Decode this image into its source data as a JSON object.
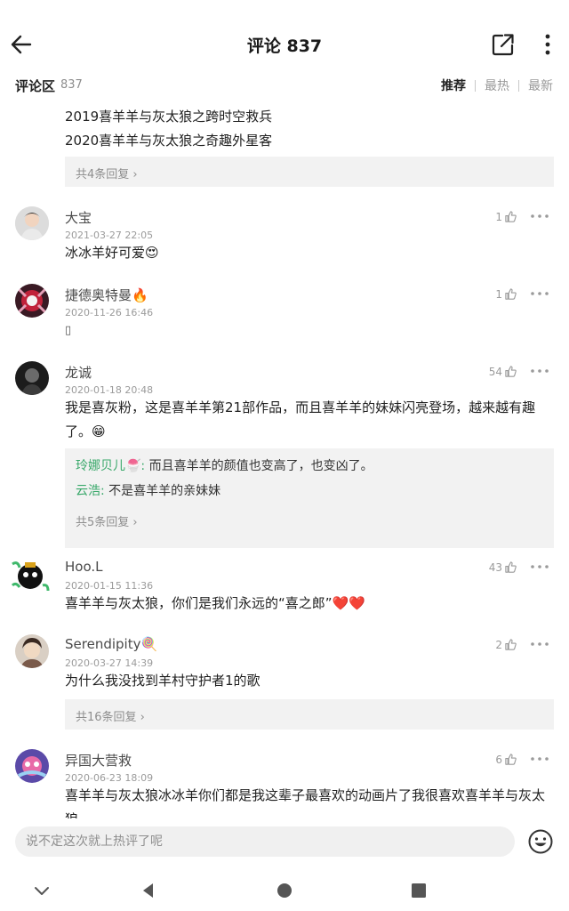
{
  "header": {
    "title": "评论 837"
  },
  "section": {
    "title": "评论区",
    "count": "837",
    "sort": {
      "recommend": "推荐",
      "hot": "最热",
      "latest": "最新"
    }
  },
  "previous_comment_tail": {
    "lines": [
      "2019喜羊羊与灰太狼之跨时空救兵",
      "2020喜羊羊与灰太狼之奇趣外星客"
    ],
    "more_replies": "共4条回复 ›"
  },
  "comments": [
    {
      "name": "大宝",
      "time": "2021-03-27 22:05",
      "text": "冰冰羊好可爱😍",
      "likes": "1"
    },
    {
      "name": "捷德奥特曼🔥",
      "time": "2020-11-26 16:46",
      "text": "▯",
      "likes": "1"
    },
    {
      "name": "龙诚",
      "time": "2020-01-18 20:48",
      "text": "我是喜灰粉，这是喜羊羊第21部作品，而且喜羊羊的妹妹闪亮登场，越来越有趣了。😁",
      "likes": "54",
      "replies": [
        {
          "user": "玲娜贝儿🍧:",
          "text": " 而且喜羊羊的颜值也变高了，也变凶了。"
        },
        {
          "user": "云浩:",
          "text": " 不是喜羊羊的亲妹妹"
        }
      ],
      "more_replies": "共5条回复 ›"
    },
    {
      "name": "Hoo.L",
      "time": "2020-01-15 11:36",
      "text": "喜羊羊与灰太狼，你们是我们永远的“喜之郎”❤️❤️",
      "likes": "43"
    },
    {
      "name": "Serendipity🍭",
      "time": "2020-03-27 14:39",
      "text": "为什么我没找到羊村守护者1的歌",
      "likes": "2",
      "more_replies": "共16条回复 ›"
    },
    {
      "name": "异国大营救",
      "time": "2020-06-23 18:09",
      "text": "喜羊羊与灰太狼冰冰羊你们都是我这辈子最喜欢的动画片了我很喜欢喜羊羊与灰太狼",
      "likes": "6"
    }
  ],
  "input": {
    "placeholder": "说不定这次就上热评了呢"
  },
  "icons": {
    "back": "arrow-left-icon",
    "share": "share-icon",
    "more": "more-vertical-icon",
    "like": "thumbs-up-icon",
    "emoji": "smiley-icon"
  },
  "colors": {
    "reply_user": "#39a86a",
    "reply_bg": "#f2f2f2"
  }
}
